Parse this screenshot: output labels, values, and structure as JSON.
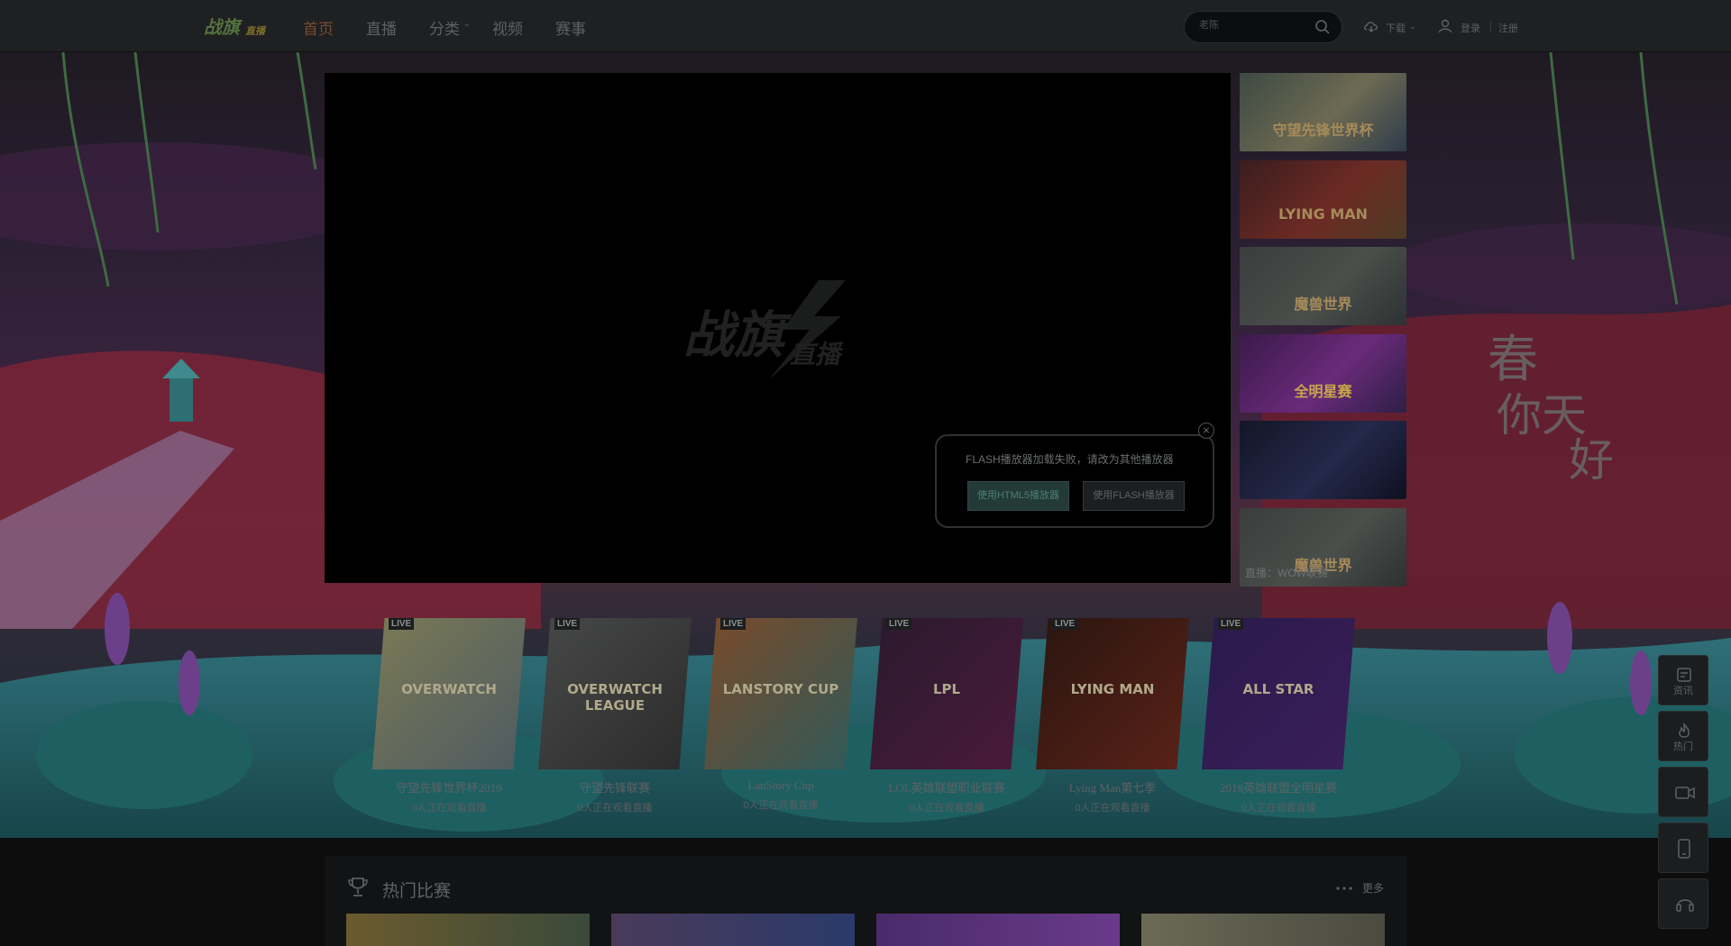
{
  "header": {
    "logo_text": "战旗",
    "logo_sub": "直播",
    "nav": [
      {
        "label": "首页",
        "active": true
      },
      {
        "label": "直播",
        "active": false
      },
      {
        "label": "分类",
        "active": false
      },
      {
        "label": "视频",
        "active": false
      },
      {
        "label": "赛事",
        "active": false
      }
    ],
    "search_placeholder": "老陈",
    "download_label": "下载",
    "login_label": "登录",
    "separator": "|",
    "register_label": "注册"
  },
  "player": {
    "flash_message": "FLASH播放器加载失败，请改为其他播放器",
    "h5_button": "使用HTML5播放器",
    "flash_button": "使用FLASH播放器",
    "close_symbol": "×"
  },
  "side_thumbs": [
    {
      "text": "守望先锋世界杯",
      "colors": [
        "#3d4a43",
        "#6d6a52",
        "#2e3c4a"
      ]
    },
    {
      "text": "LYING MAN",
      "colors": [
        "#3a1d1e",
        "#6c2a24",
        "#4f3a25"
      ]
    },
    {
      "text": "魔兽世界",
      "colors": [
        "#3a3d3c",
        "#4a4f4b",
        "#2d3132"
      ]
    },
    {
      "text": "全明星赛",
      "colors": [
        "#3a1a4a",
        "#6a2a7a",
        "#2d1f45"
      ]
    },
    {
      "text": "",
      "colors": [
        "#121626",
        "#24284a",
        "#0e1120"
      ]
    },
    {
      "text": "魔兽世界",
      "colors": [
        "#3a3d3c",
        "#4a4f4b",
        "#2d3132"
      ]
    }
  ],
  "side_caption": "直播：WOW联赛",
  "live_cards": [
    {
      "badge": "LIVE",
      "title": "守望先锋世界杯2019",
      "viewers": "0人正在观看直播",
      "logo": "OVERWATCH",
      "bg": [
        "#7a7a55",
        "#4e5a62"
      ]
    },
    {
      "badge": "LIVE",
      "title": "守望先锋联赛",
      "viewers": "0人正在观看直播",
      "logo": "OVERWATCH LEAGUE",
      "bg": [
        "#474848",
        "#2b2b2b"
      ]
    },
    {
      "badge": "LIVE",
      "title": "LanStory Cup",
      "viewers": "0人正在观看直播",
      "logo": "LANSTORY CUP",
      "bg": [
        "#7a4a2a",
        "#2f5a5a"
      ]
    },
    {
      "badge": "LIVE",
      "title": "LOL英雄联盟职业联赛",
      "viewers": "0人正在观看直播",
      "logo": "LPL",
      "bg": [
        "#2a1a2e",
        "#4a1a3a"
      ]
    },
    {
      "badge": "LIVE",
      "title": "Lying Man第七季",
      "viewers": "0人正在观看直播",
      "logo": "LYING MAN",
      "bg": [
        "#2a1510",
        "#5a2218"
      ]
    },
    {
      "badge": "LIVE",
      "title": "2018英雄联盟全明星赛",
      "viewers": "0人正在观看直播",
      "logo": "ALL STAR",
      "bg": [
        "#2a1a4a",
        "#3a1e5a"
      ]
    }
  ],
  "float_bar": [
    {
      "label": "资讯",
      "icon": "news-icon"
    },
    {
      "label": "热门",
      "icon": "fire-icon"
    },
    {
      "label": "",
      "icon": "camera-icon"
    },
    {
      "label": "",
      "icon": "phone-icon"
    },
    {
      "label": "",
      "icon": "headset-icon"
    }
  ],
  "hot": {
    "title": "热门比赛",
    "more": "更多"
  }
}
